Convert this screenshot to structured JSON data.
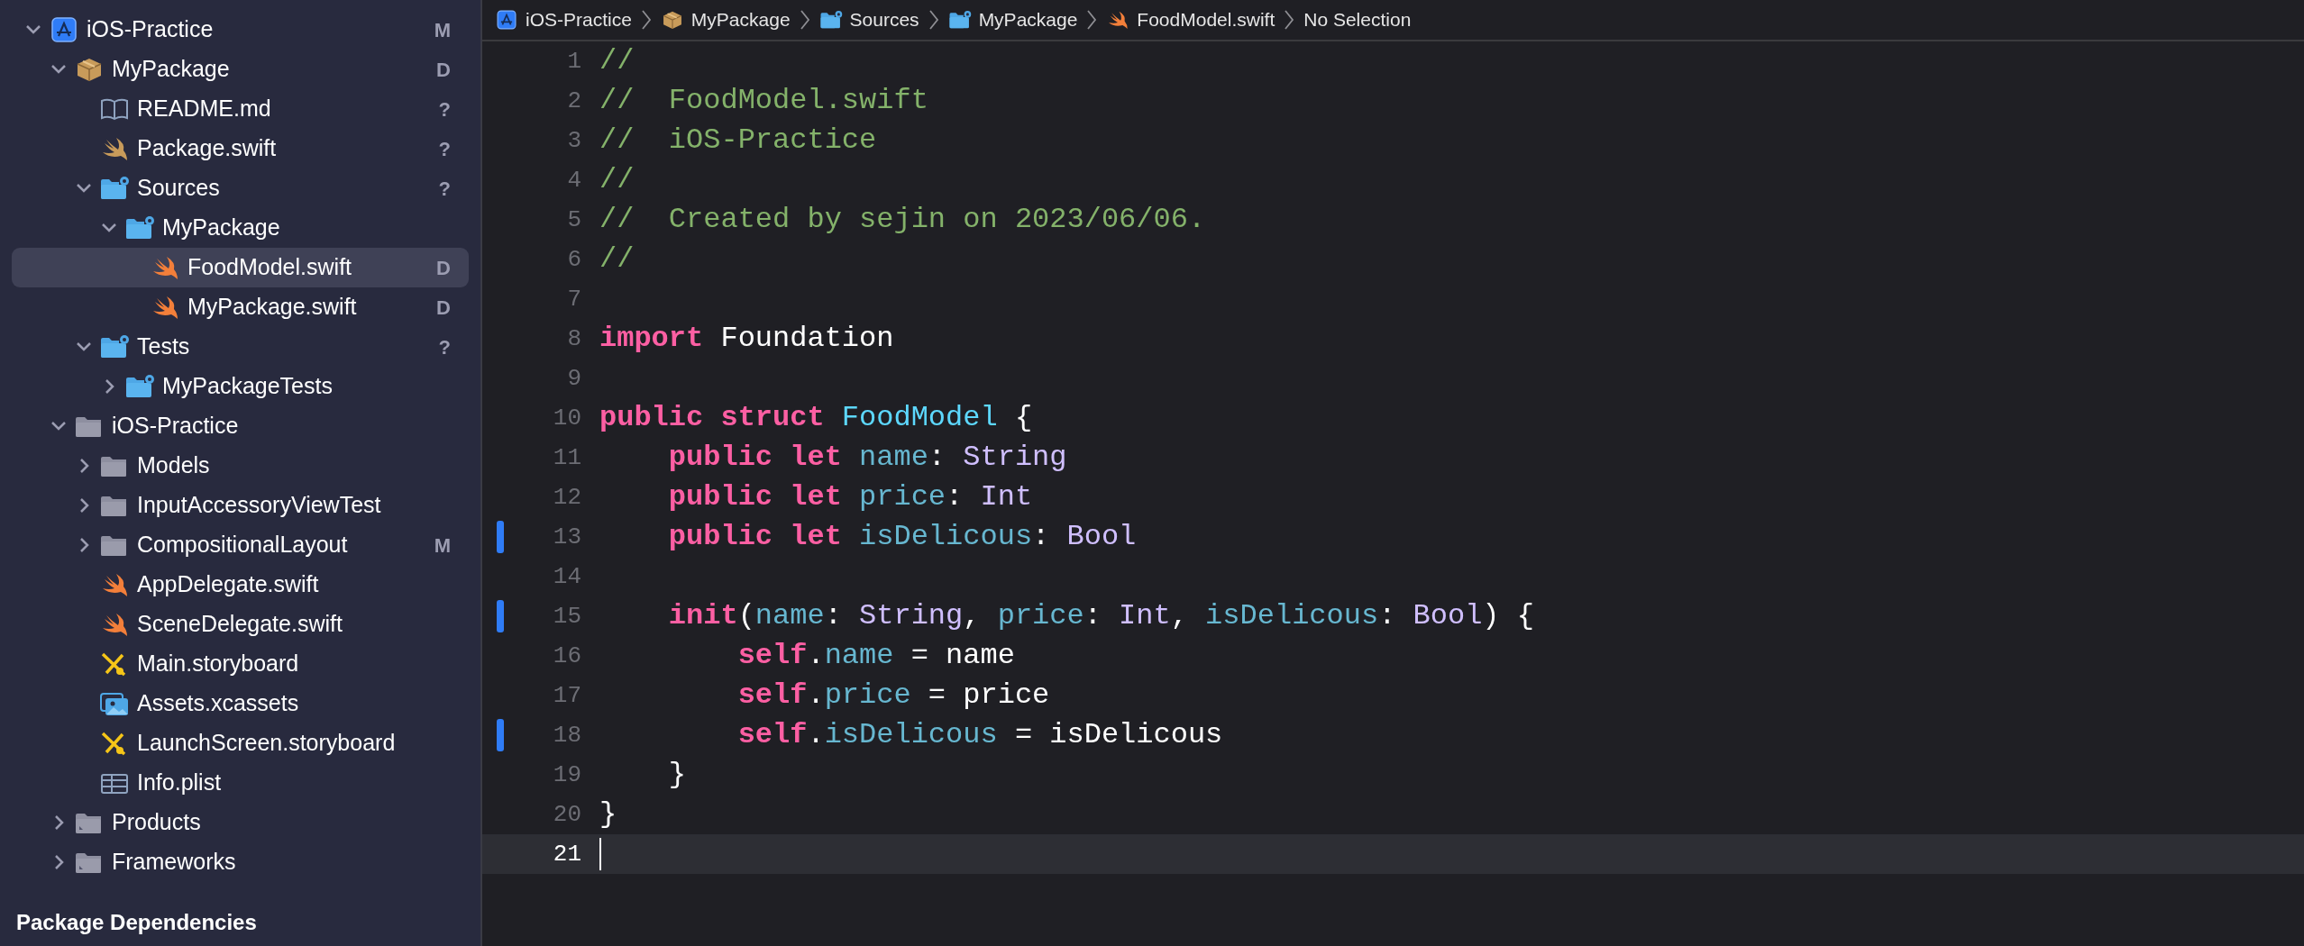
{
  "navigator": {
    "tree": [
      {
        "label": "iOS-Practice",
        "kind": "project",
        "expanded": true,
        "status": "M",
        "selected": false,
        "children": [
          {
            "label": "MyPackage",
            "kind": "package",
            "expanded": true,
            "status": "D",
            "selected": false,
            "children": [
              {
                "label": "README.md",
                "kind": "book",
                "status": "?",
                "selected": false
              },
              {
                "label": "Package.swift",
                "kind": "swift-muted",
                "status": "?",
                "selected": false
              },
              {
                "label": "Sources",
                "kind": "folder-gear",
                "expanded": true,
                "status": "?",
                "selected": false,
                "children": [
                  {
                    "label": "MyPackage",
                    "kind": "folder-gear",
                    "expanded": true,
                    "selected": false,
                    "children": [
                      {
                        "label": "FoodModel.swift",
                        "kind": "swift",
                        "status": "D",
                        "selected": true
                      },
                      {
                        "label": "MyPackage.swift",
                        "kind": "swift",
                        "status": "D",
                        "selected": false
                      }
                    ]
                  }
                ]
              },
              {
                "label": "Tests",
                "kind": "folder-gear",
                "expanded": true,
                "status": "?",
                "selected": false,
                "children": [
                  {
                    "label": "MyPackageTests",
                    "kind": "folder-gear",
                    "expanded": false,
                    "selected": false
                  }
                ]
              }
            ]
          },
          {
            "label": "iOS-Practice",
            "kind": "folder",
            "expanded": true,
            "selected": false,
            "children": [
              {
                "label": "Models",
                "kind": "folder",
                "expanded": false,
                "selected": false
              },
              {
                "label": "InputAccessoryViewTest",
                "kind": "folder",
                "expanded": false,
                "selected": false
              },
              {
                "label": "CompositionalLayout",
                "kind": "folder",
                "expanded": false,
                "status": "M",
                "selected": false
              },
              {
                "label": "AppDelegate.swift",
                "kind": "swift",
                "selected": false
              },
              {
                "label": "SceneDelegate.swift",
                "kind": "swift",
                "selected": false
              },
              {
                "label": "Main.storyboard",
                "kind": "storyboard",
                "selected": false
              },
              {
                "label": "Assets.xcassets",
                "kind": "assets",
                "selected": false
              },
              {
                "label": "LaunchScreen.storyboard",
                "kind": "storyboard",
                "selected": false
              },
              {
                "label": "Info.plist",
                "kind": "plist",
                "selected": false
              }
            ]
          },
          {
            "label": "Products",
            "kind": "folder-special",
            "expanded": false,
            "selected": false
          },
          {
            "label": "Frameworks",
            "kind": "folder-special",
            "expanded": false,
            "selected": false
          }
        ]
      }
    ],
    "section_title": "Package Dependencies"
  },
  "breadcrumb": [
    {
      "label": "iOS-Practice",
      "kind": "project"
    },
    {
      "label": "MyPackage",
      "kind": "package"
    },
    {
      "label": "Sources",
      "kind": "folder-gear"
    },
    {
      "label": "MyPackage",
      "kind": "folder-gear"
    },
    {
      "label": "FoodModel.swift",
      "kind": "swift"
    },
    {
      "label": "No Selection",
      "kind": "none"
    }
  ],
  "editor": {
    "lines": [
      {
        "number": "1",
        "changed": false,
        "current": false,
        "tokens": [
          {
            "kind": "comment",
            "text": "//"
          }
        ]
      },
      {
        "number": "2",
        "changed": false,
        "current": false,
        "tokens": [
          {
            "kind": "comment",
            "text": "//  FoodModel.swift"
          }
        ]
      },
      {
        "number": "3",
        "changed": false,
        "current": false,
        "tokens": [
          {
            "kind": "comment",
            "text": "//  iOS-Practice"
          }
        ]
      },
      {
        "number": "4",
        "changed": false,
        "current": false,
        "tokens": [
          {
            "kind": "comment",
            "text": "//"
          }
        ]
      },
      {
        "number": "5",
        "changed": false,
        "current": false,
        "tokens": [
          {
            "kind": "comment",
            "text": "//  Created by sejin on 2023/06/06."
          }
        ]
      },
      {
        "number": "6",
        "changed": false,
        "current": false,
        "tokens": [
          {
            "kind": "comment",
            "text": "//"
          }
        ]
      },
      {
        "number": "7",
        "changed": false,
        "current": false
      },
      {
        "number": "8",
        "changed": false,
        "current": false,
        "tokens": [
          {
            "kind": "keyword",
            "text": "import"
          },
          {
            "kind": "plain",
            "text": " Foundation"
          }
        ]
      },
      {
        "number": "9",
        "changed": false,
        "current": false
      },
      {
        "number": "10",
        "changed": false,
        "current": false,
        "tokens": [
          {
            "kind": "keyword",
            "text": "public struct "
          },
          {
            "kind": "declaration",
            "text": "FoodModel"
          },
          {
            "kind": "plain",
            "text": " {"
          }
        ]
      },
      {
        "number": "11",
        "changed": false,
        "current": false,
        "tokens": [
          {
            "kind": "keyword",
            "text": "    public let "
          },
          {
            "kind": "property",
            "text": "name"
          },
          {
            "kind": "plain",
            "text": ": "
          },
          {
            "kind": "type",
            "text": "String"
          }
        ]
      },
      {
        "number": "12",
        "changed": false,
        "current": false,
        "tokens": [
          {
            "kind": "keyword",
            "text": "    public let "
          },
          {
            "kind": "property",
            "text": "price"
          },
          {
            "kind": "plain",
            "text": ": "
          },
          {
            "kind": "type",
            "text": "Int"
          }
        ]
      },
      {
        "number": "13",
        "changed": true,
        "current": false,
        "tokens": [
          {
            "kind": "keyword",
            "text": "    public let "
          },
          {
            "kind": "property",
            "text": "isDelicous"
          },
          {
            "kind": "plain",
            "text": ": "
          },
          {
            "kind": "type",
            "text": "Bool"
          }
        ]
      },
      {
        "number": "14",
        "changed": false,
        "current": false
      },
      {
        "number": "15",
        "changed": true,
        "current": false,
        "tokens": [
          {
            "kind": "keyword",
            "text": "    init"
          },
          {
            "kind": "plain",
            "text": "("
          },
          {
            "kind": "property",
            "text": "name"
          },
          {
            "kind": "plain",
            "text": ": "
          },
          {
            "kind": "type",
            "text": "String"
          },
          {
            "kind": "plain",
            "text": ", "
          },
          {
            "kind": "property",
            "text": "price"
          },
          {
            "kind": "plain",
            "text": ": "
          },
          {
            "kind": "type",
            "text": "Int"
          },
          {
            "kind": "plain",
            "text": ", "
          },
          {
            "kind": "property",
            "text": "isDelicous"
          },
          {
            "kind": "plain",
            "text": ": "
          },
          {
            "kind": "type",
            "text": "Bool"
          },
          {
            "kind": "plain",
            "text": ") {"
          }
        ]
      },
      {
        "number": "16",
        "changed": false,
        "current": false,
        "tokens": [
          {
            "kind": "keyword",
            "text": "        self"
          },
          {
            "kind": "plain",
            "text": "."
          },
          {
            "kind": "property",
            "text": "name"
          },
          {
            "kind": "plain",
            "text": " = name"
          }
        ]
      },
      {
        "number": "17",
        "changed": false,
        "current": false,
        "tokens": [
          {
            "kind": "keyword",
            "text": "        self"
          },
          {
            "kind": "plain",
            "text": "."
          },
          {
            "kind": "property",
            "text": "price"
          },
          {
            "kind": "plain",
            "text": " = price"
          }
        ]
      },
      {
        "number": "18",
        "changed": true,
        "current": false,
        "tokens": [
          {
            "kind": "keyword",
            "text": "        self"
          },
          {
            "kind": "plain",
            "text": "."
          },
          {
            "kind": "property",
            "text": "isDelicous"
          },
          {
            "kind": "plain",
            "text": " = isDelicous"
          }
        ]
      },
      {
        "number": "19",
        "changed": false,
        "current": false,
        "tokens": [
          {
            "kind": "plain",
            "text": "    }"
          }
        ]
      },
      {
        "number": "20",
        "changed": false,
        "current": false,
        "tokens": [
          {
            "kind": "plain",
            "text": "}"
          }
        ]
      },
      {
        "number": "21",
        "changed": false,
        "current": true
      }
    ]
  }
}
